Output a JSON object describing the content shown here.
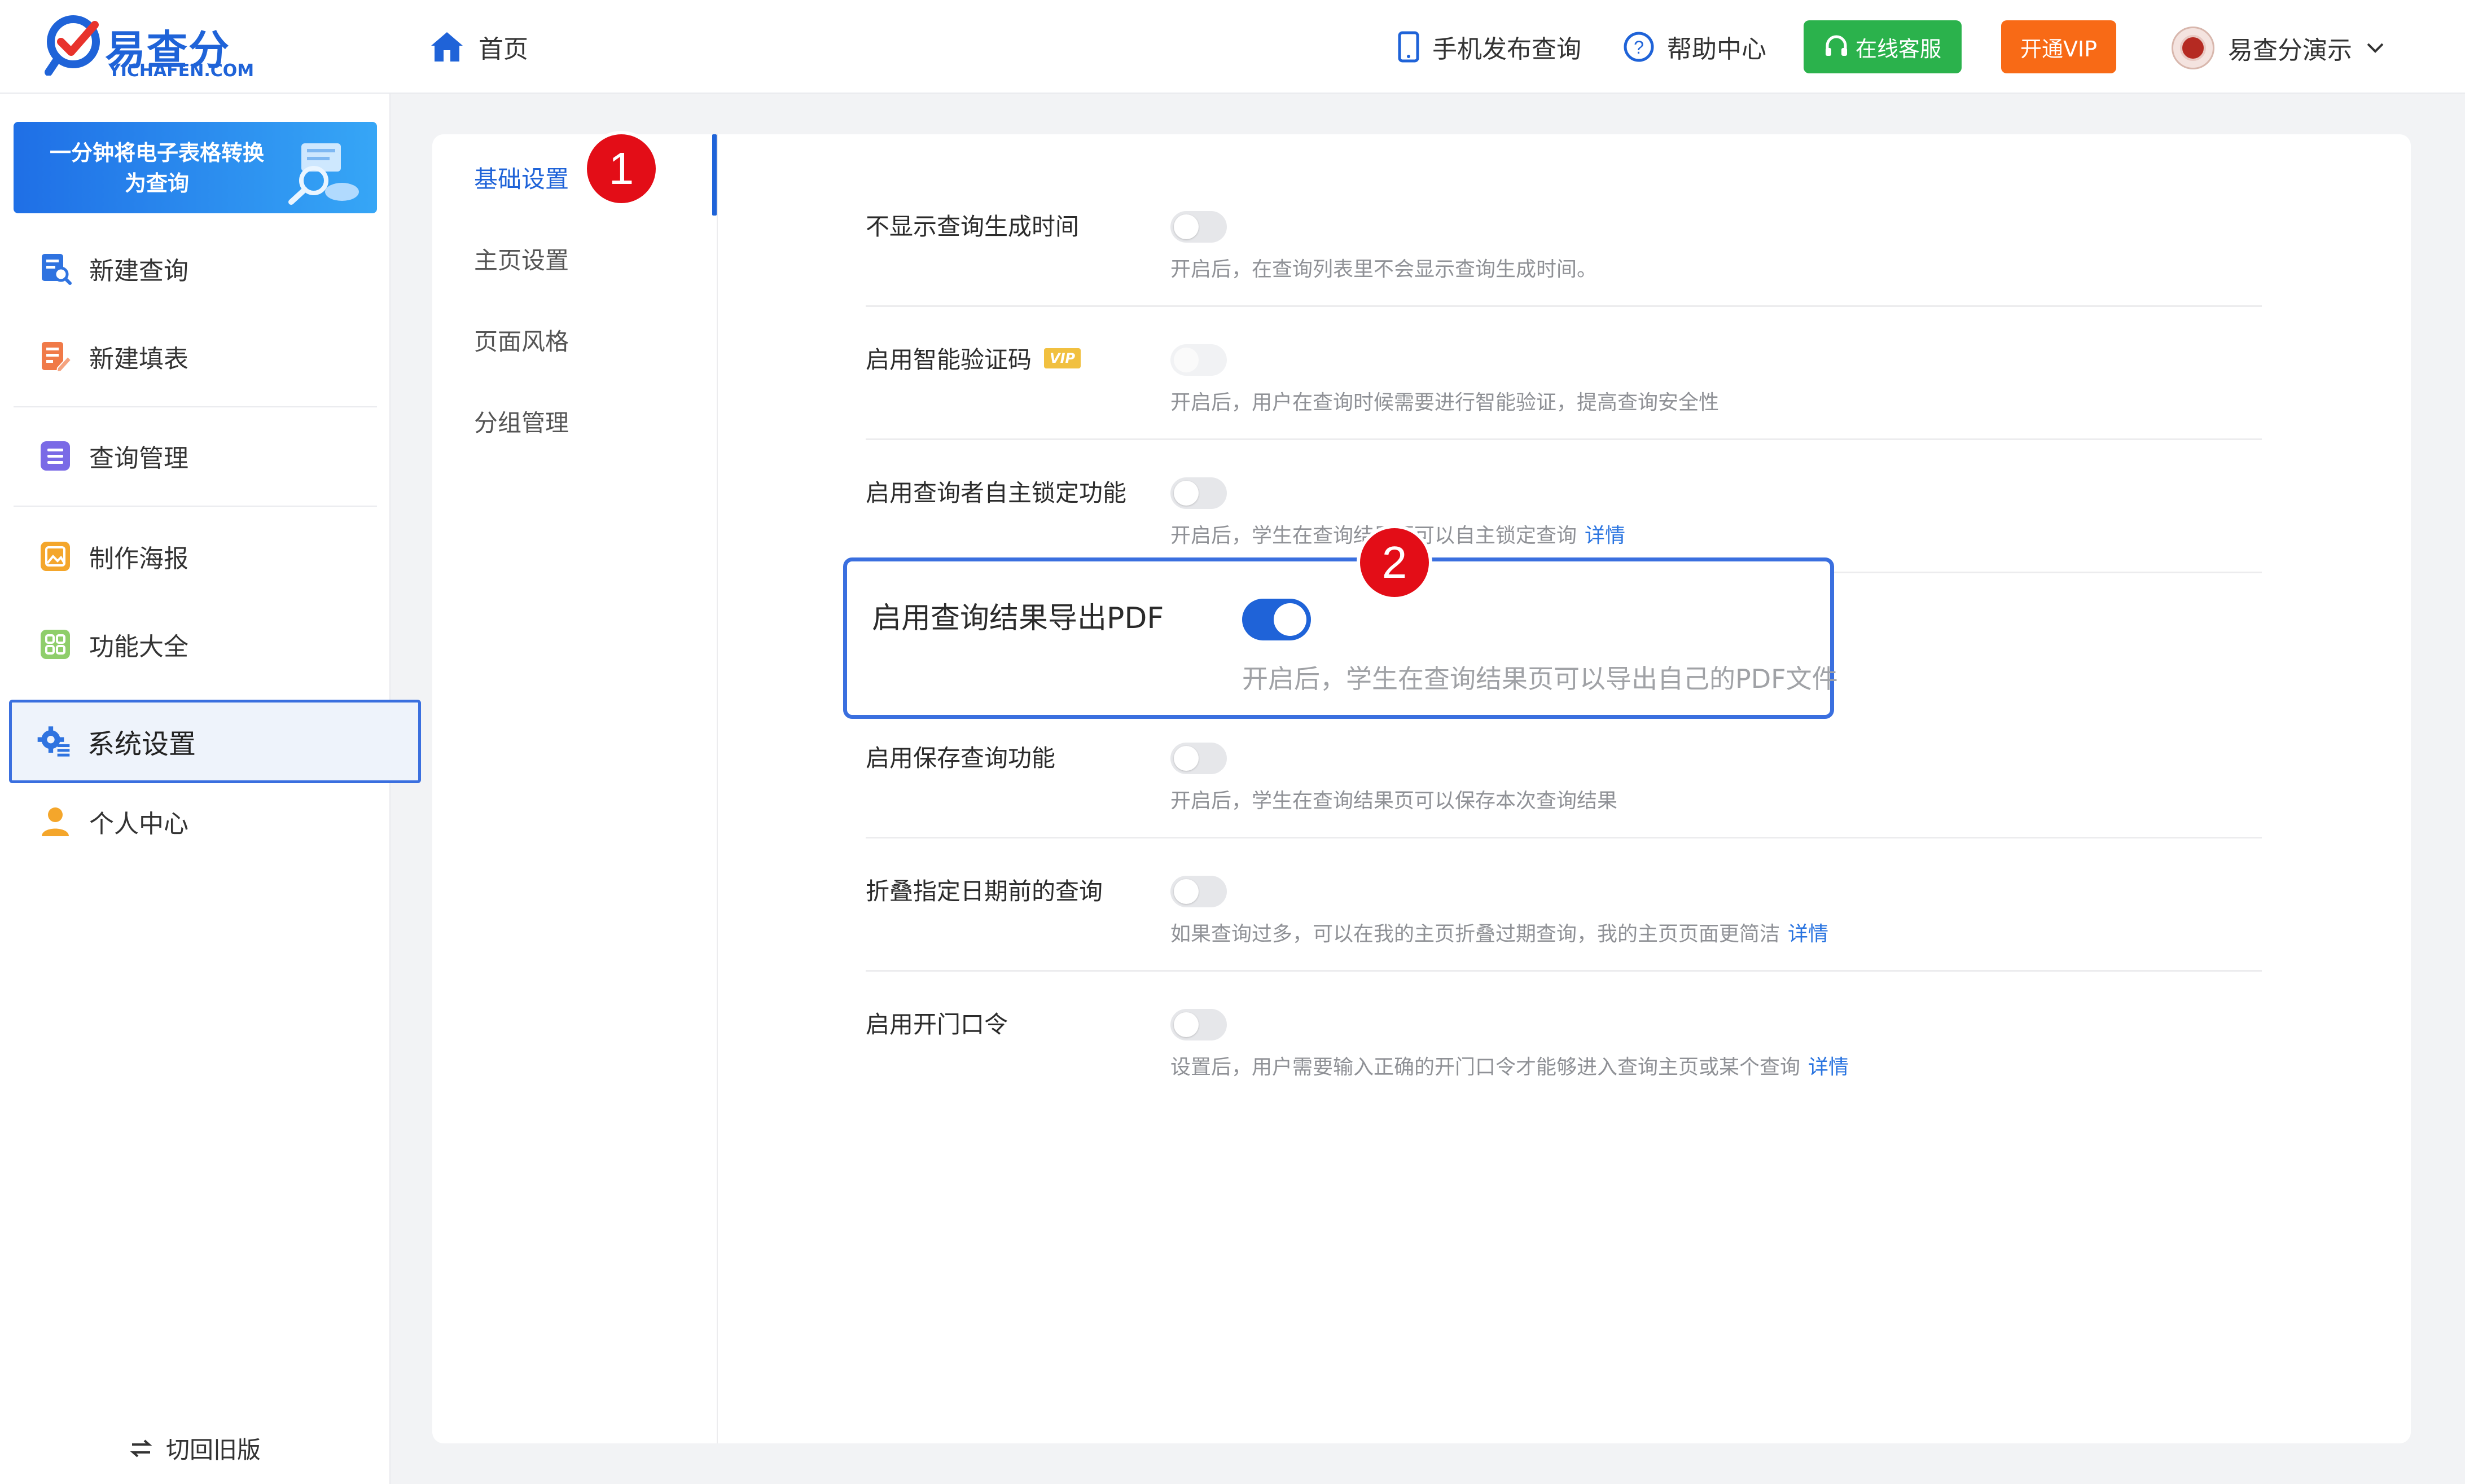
{
  "header": {
    "logo_text": "易查分",
    "logo_sub": "YICHAFEN.COM",
    "home_label": "首页",
    "mobile_publish": "手机发布查询",
    "help_center": "帮助中心",
    "online_service": "在线客服",
    "vip_button": "开通VIP",
    "user_name": "易查分演示"
  },
  "sidebar": {
    "banner_text": "一分钟将电子表格转换为查询",
    "items": [
      {
        "label": "新建查询",
        "icon": "search-doc-icon"
      },
      {
        "label": "新建填表",
        "icon": "form-edit-icon"
      },
      {
        "label": "查询管理",
        "icon": "list-icon"
      },
      {
        "label": "制作海报",
        "icon": "poster-icon"
      },
      {
        "label": "功能大全",
        "icon": "grid-icon"
      },
      {
        "label": "系统设置",
        "icon": "settings-gear-icon",
        "active": true
      },
      {
        "label": "个人中心",
        "icon": "user-icon"
      }
    ],
    "switch_old": "切回旧版"
  },
  "sub_nav": {
    "items": [
      "基础设置",
      "主页设置",
      "页面风格",
      "分组管理"
    ],
    "active": "基础设置"
  },
  "badges": [
    "1",
    "2"
  ],
  "settings": [
    {
      "label": "不显示查询生成时间",
      "desc": "开启后，在查询列表里不会显示查询生成时间。",
      "enabled": false
    },
    {
      "label": "启用智能验证码",
      "vip": "VIP",
      "desc": "开启后，用户在查询时候需要进行智能验证，提高查询安全性",
      "enabled": false,
      "disabled": true
    },
    {
      "label": "启用查询者自主锁定功能",
      "desc": "开启后，学生在查询结果页可以自主锁定查询",
      "link": "详情",
      "enabled": false
    },
    {
      "label": "启用查询结果导出PDF",
      "desc": "开启后，学生在查询结果页可以导出自己的PDF文件",
      "enabled": true,
      "highlighted": true
    },
    {
      "label": "启用保存查询功能",
      "desc": "开启后，学生在查询结果页可以保存本次查询结果",
      "enabled": false
    },
    {
      "label": "折叠指定日期前的查询",
      "desc": "如果查询过多，可以在我的主页折叠过期查询，我的主页页面更简洁",
      "link": "详情",
      "enabled": false
    },
    {
      "label": "启用开门口令",
      "desc": "设置后，用户需要输入正确的开门口令才能够进入查询主页或某个查询",
      "link": "详情",
      "enabled": false
    }
  ],
  "colors": {
    "primary": "#1f63d8",
    "green": "#2bb24c",
    "orange": "#f86a16",
    "badge_red": "#e30d17",
    "highlight_border": "#3a6fdf"
  }
}
